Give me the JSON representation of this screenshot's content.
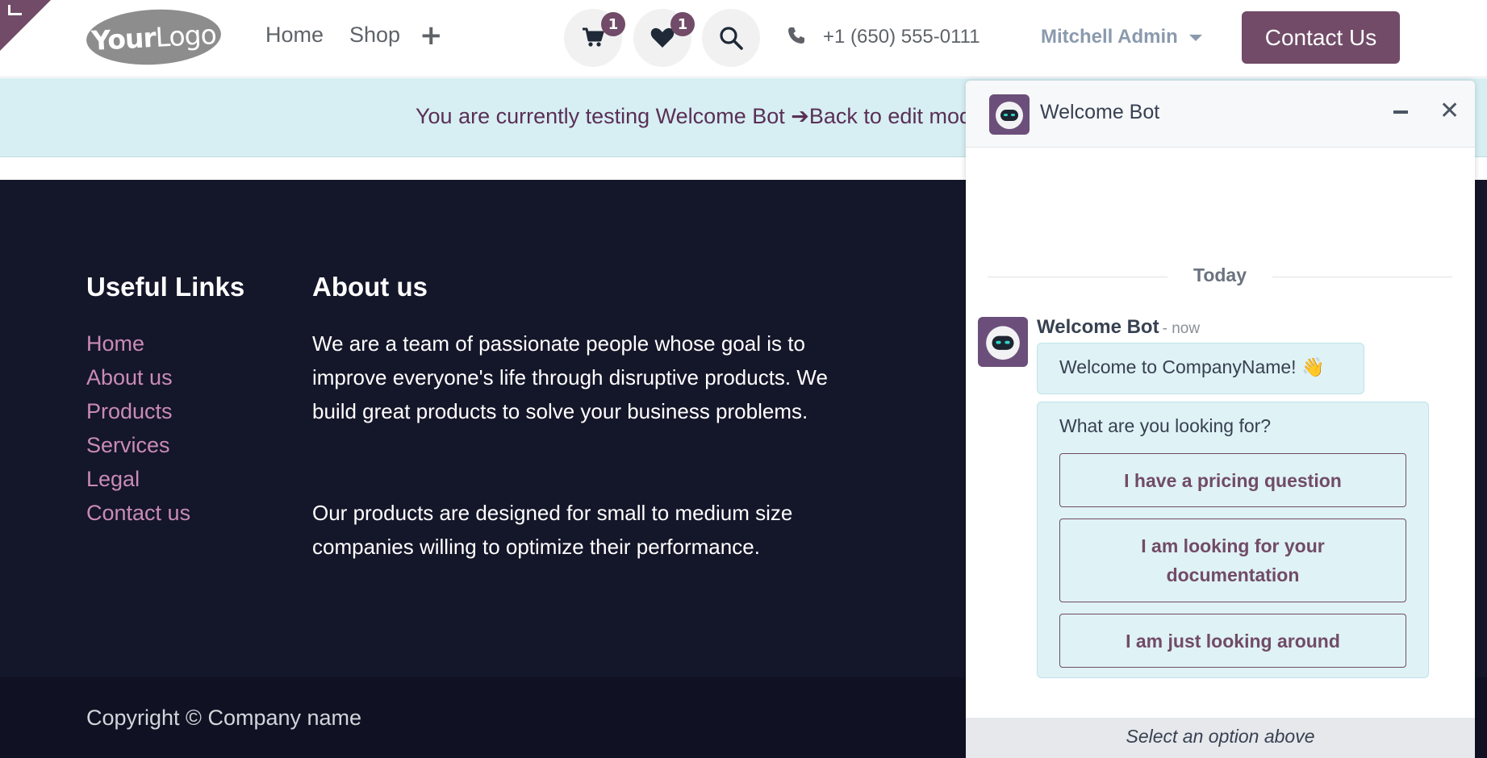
{
  "header": {
    "logo": {
      "bold": "Your",
      "light": "Logo"
    },
    "nav": [
      {
        "label": "Home"
      },
      {
        "label": "Shop"
      }
    ],
    "add_icon": "+",
    "cart_count": "1",
    "wishlist_count": "1",
    "phone": "+1 (650) 555-0111",
    "user_name": "Mitchell Admin",
    "contact_button": "Contact Us"
  },
  "banner": {
    "prefix": "You are currently testing Welcome Bot ",
    "arrow": "➔",
    "back_link": "Back to edit mode"
  },
  "footer": {
    "useful_links_heading": "Useful Links",
    "useful_links": [
      "Home",
      "About us",
      "Products",
      "Services",
      "Legal",
      "Contact us"
    ],
    "about_heading": "About us",
    "about_para_1": "We are a team of passionate people whose goal is to improve everyone's life through disruptive products. We build great products to solve your business problems.",
    "about_para_2": "Our products are designed for small to medium size companies willing to optimize their performance.",
    "copyright": "Copyright © Company name"
  },
  "chat": {
    "title": "Welcome Bot",
    "day_separator": "Today",
    "author": "Welcome Bot",
    "time": "- now",
    "welcome_message": "Welcome to CompanyName! 👋",
    "question": "What are you looking for?",
    "options": [
      "I have a pricing question",
      "I am looking for your documentation",
      "I am just looking around"
    ],
    "footer_hint": "Select an option above"
  },
  "colors": {
    "brand": "#714b67",
    "banner_bg": "#d7eff3",
    "footer_bg": "#141629",
    "link": "#c98bb6",
    "bubble_bg": "#dff2f5"
  },
  "icons": [
    "cart-icon",
    "heart-icon",
    "search-icon",
    "phone-icon",
    "minimize-icon",
    "close-icon",
    "bot-avatar"
  ]
}
